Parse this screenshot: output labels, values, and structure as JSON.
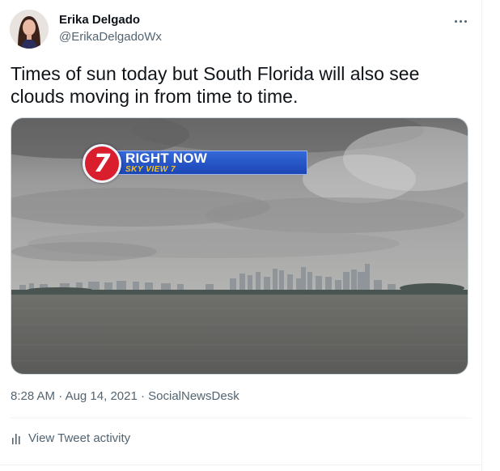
{
  "author": {
    "name": "Erika Delgado",
    "handle": "@ErikaDelgadoWx"
  },
  "tweet": {
    "text": "Times of sun today but South Florida will also see clouds moving in from time to time.",
    "time": "8:28 AM",
    "date": "Aug 14, 2021",
    "source": "SocialNewsDesk",
    "separator": " · "
  },
  "media": {
    "channel_number": "7",
    "headline": "RIGHT NOW",
    "subheadline": "SKY VIEW 7",
    "colors": {
      "logo_red": "#d91f2e",
      "bar_blue": "#2856c7",
      "sub_yellow": "#f6c31b"
    }
  },
  "actions": {
    "view_activity": "View Tweet activity"
  },
  "icons": {
    "more": "more-dots-icon",
    "activity": "bar-chart-icon"
  }
}
